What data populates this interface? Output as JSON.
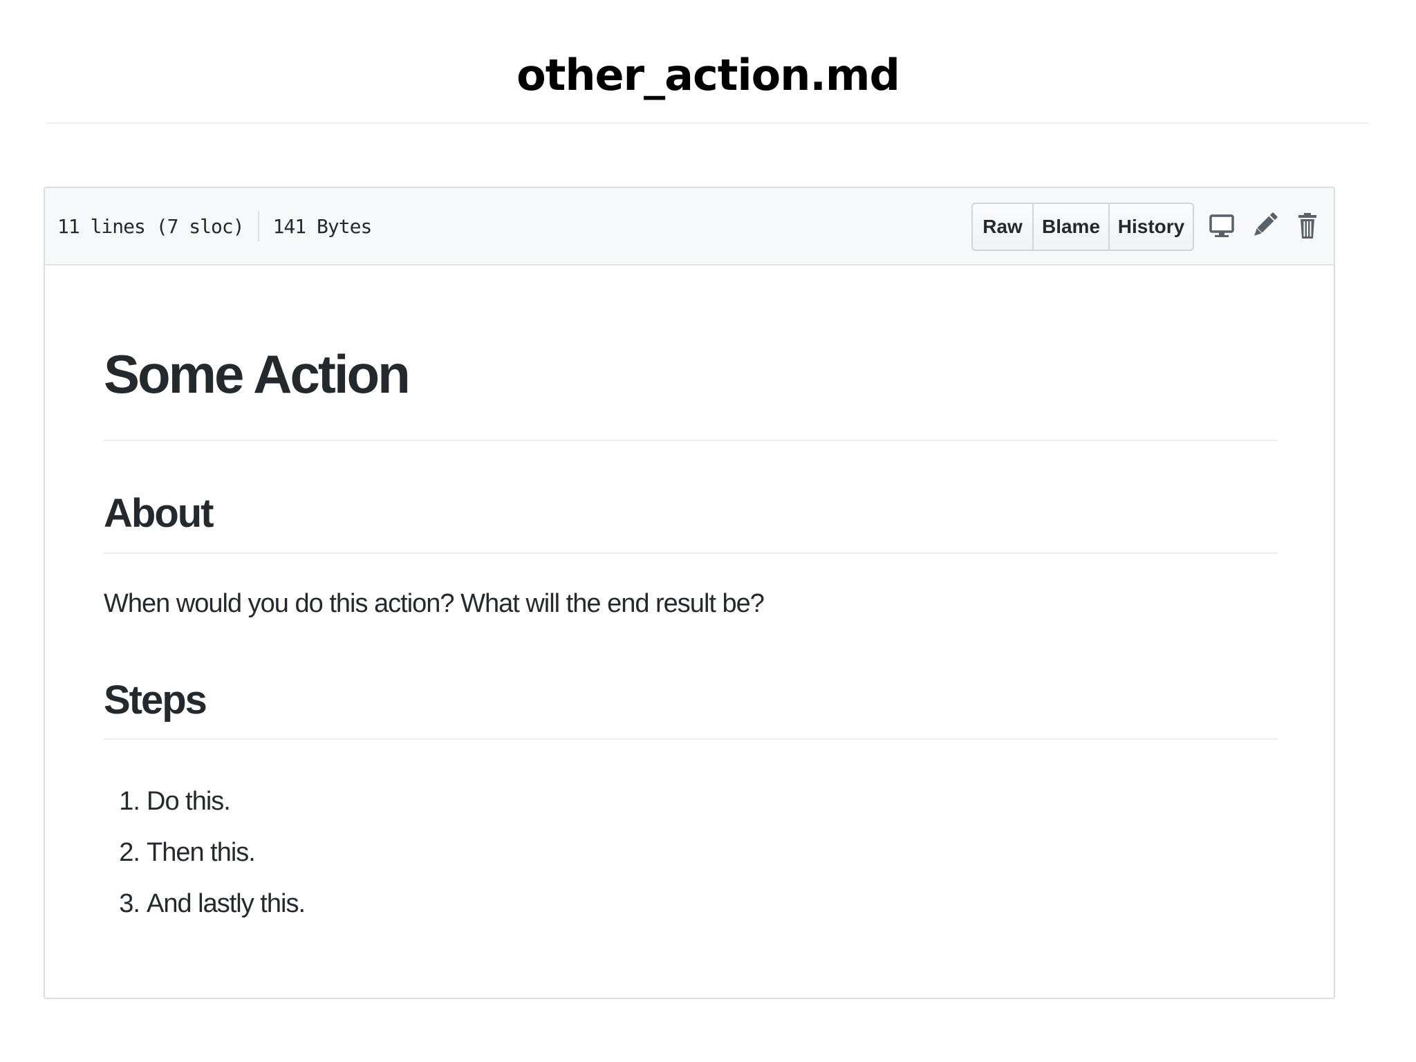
{
  "slide": {
    "title": "other_action.md"
  },
  "file_header": {
    "lines": "11 lines (7 sloc)",
    "size": "141 Bytes",
    "buttons": {
      "raw": "Raw",
      "blame": "Blame",
      "history": "History"
    },
    "icons": [
      "desktop-icon",
      "pencil-icon",
      "trash-icon"
    ]
  },
  "markdown": {
    "h1": "Some Action",
    "about_heading": "About",
    "about_text": "When would you do this action? What will the end result be?",
    "steps_heading": "Steps",
    "steps": [
      {
        "num": "1.",
        "text": "Do this."
      },
      {
        "num": "2.",
        "text": "Then this."
      },
      {
        "num": "3.",
        "text": "And lastly this."
      }
    ]
  },
  "colors": {
    "text": "#24292e",
    "header_bg": "#f6f8fa",
    "border": "#dddddd",
    "rule": "#eaecef"
  }
}
